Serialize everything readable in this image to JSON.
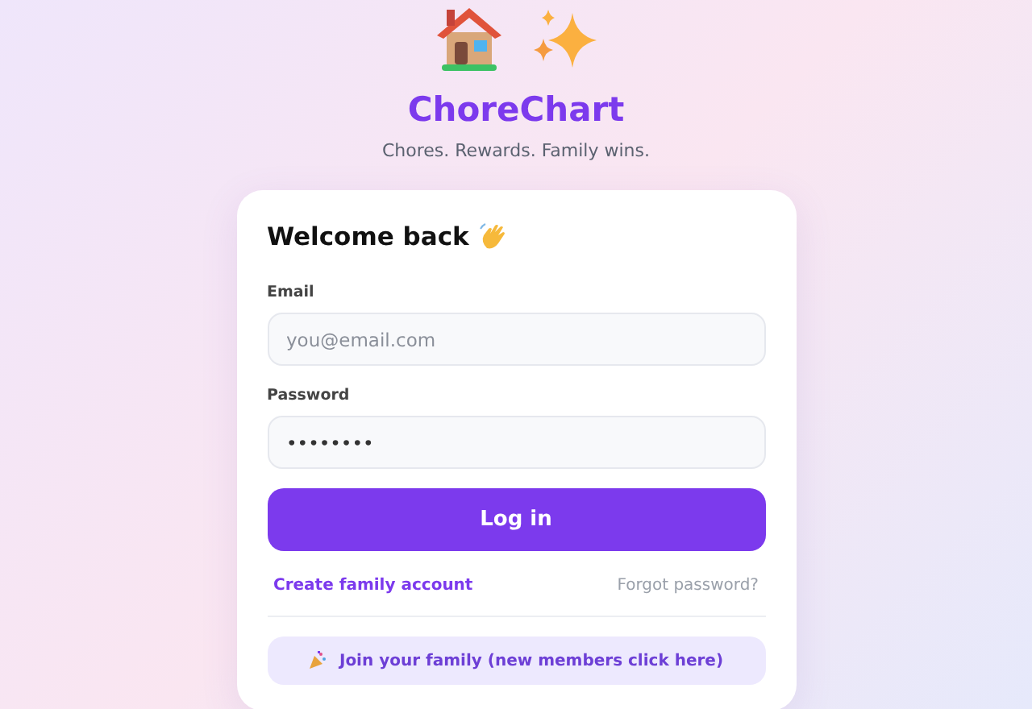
{
  "app": {
    "title": "ChoreChart",
    "tagline": "Chores. Rewards. Family wins."
  },
  "login": {
    "heading": "Welcome back",
    "fields": [
      {
        "label": "Email",
        "placeholder": "you@email.com"
      },
      {
        "label": "Password",
        "value": "••••••••"
      }
    ],
    "submit": "Log in",
    "links": [
      {
        "text": "Create family account",
        "kind": "primary"
      },
      {
        "text": "Forgot password?",
        "kind": "muted"
      }
    ],
    "join": "Join your family (new members click here)"
  }
}
